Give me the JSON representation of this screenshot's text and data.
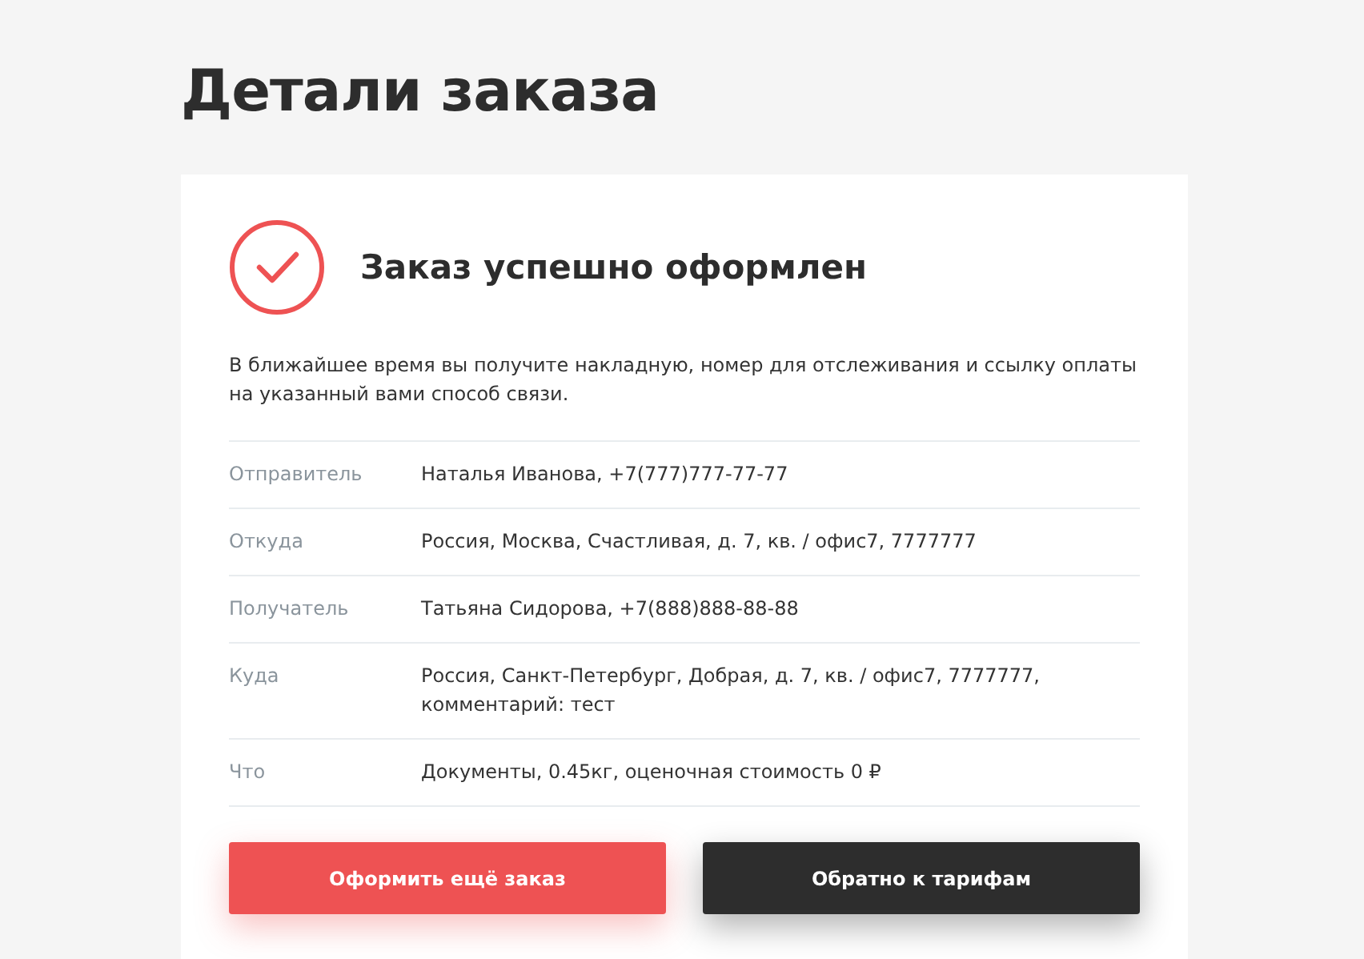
{
  "page_title": "Детали заказа",
  "status": {
    "heading": "Заказ успешно оформлен",
    "message": "В ближайшее время вы получите накладную, номер для отслеживания и ссылку оплаты на указанный вами способ связи."
  },
  "details": [
    {
      "label": "Отправитель",
      "value": "Наталья Иванова, +7(777)777-77-77"
    },
    {
      "label": "Откуда",
      "value": "Россия, Москва, Счастливая, д. 7, кв. / офис7, 7777777"
    },
    {
      "label": "Получатель",
      "value": "Татьяна Сидорова, +7(888)888-88-88"
    },
    {
      "label": "Куда",
      "value": "Россия, Санкт-Петербург, Добрая, д. 7, кв. / офис7, 7777777, комментарий: тест"
    },
    {
      "label": "Что",
      "value": "Документы, 0.45кг, оценочная стоимость 0 ₽"
    }
  ],
  "buttons": [
    {
      "label": "Оформить ещё заказ",
      "kind": "primary"
    },
    {
      "label": "Обратно к тарифам",
      "kind": "dark"
    }
  ]
}
